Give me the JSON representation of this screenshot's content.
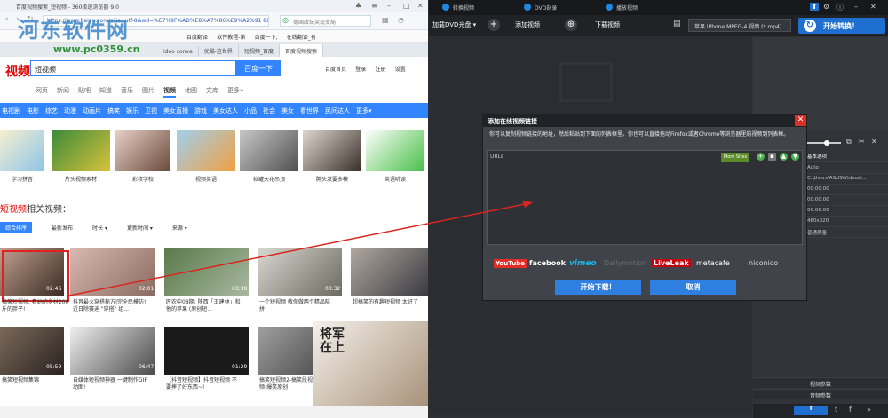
{
  "browser": {
    "title": "百度视频搜索_短视频 - 360极速浏览器 9.0",
    "url": "https://www.baidu.com/s?ie=utf-8&wd=%E7%9F%AD%E8%A7%86%E9%A2%91 8&word=%E6%9",
    "search_placeholder": "德国政坛突现变局",
    "bookmarks": [
      "百度翻译",
      "软件教程-第",
      "百度一下,",
      "在线翻译_有"
    ],
    "tabs": [
      "ideo conve",
      "优酷-这世界",
      "短视频_百度",
      "百度视频搜索"
    ],
    "watermark": "河东软件网",
    "watermark_url": "www.pc0359.cn"
  },
  "baidu": {
    "logo": "视频",
    "query": "短视频",
    "search_button": "百度一下",
    "links": [
      "百度首页",
      "登录",
      "注册",
      "设置"
    ],
    "nav1": [
      "网页",
      "新闻",
      "贴吧",
      "知道",
      "音乐",
      "图片",
      "视频",
      "地图",
      "文库",
      "更多»"
    ],
    "nav2": [
      "电视剧",
      "电影",
      "综艺",
      "动漫",
      "动画片",
      "搞笑",
      "娱乐",
      "卫视",
      "美女直播",
      "游戏",
      "美女达人",
      "小品",
      "社会",
      "美女",
      "看世界",
      "民间达人",
      "更多▾"
    ],
    "top_thumbs": [
      "学习拼音",
      "片头视频素材",
      "彩妆学校",
      "视频英语",
      "软罐天花吊顶",
      "肿头发要多模",
      "英语听读"
    ],
    "related_prefix": "短视频",
    "related_suffix": "相关视频：",
    "sort_tabs": [
      "综合排序",
      "最新发布",
      "时长 ▾",
      "更新时间 ▾",
      "来源 ▾"
    ],
    "videos": [
      {
        "dur": "02:46",
        "cap": "搞笑短视频, 看她的身材200斤的胖子!"
      },
      {
        "dur": "02:01",
        "cap": "抖音最火穿搭秘方|完全民模仿! 近日除赛迪 \"穿搭\" 组..."
      },
      {
        "dur": "03:38",
        "cap": "匠农中08期: 陕西「王建林」和他的苹果 (原创短..."
      },
      {
        "dur": "03:32",
        "cap": "一个短视频 教你做两个精品陪拼"
      },
      {
        "dur": "",
        "cap": "超搞笑的有趣短视频 太好了"
      },
      {
        "dur": "05:59",
        "cap": "搞笑短视频集锦"
      },
      {
        "dur": "06:47",
        "cap": "自媒体短视频神器 一键制作GIF动图!"
      },
      {
        "dur": "01:29",
        "cap": "【抖音短视频】抖音短视频 不要摔了好东西~!"
      },
      {
        "dur": "",
        "cap": "搞笑短视频2-搞笑段视频-爆笑原创"
      },
      {
        "dur": "",
        "cap": "将军在上"
      }
    ]
  },
  "app": {
    "tabs": [
      "转换视频",
      "DVD刻录",
      "播放视频"
    ],
    "toolbar": [
      "加载DVD光盘 ▾",
      "添加视频",
      "下载视频"
    ],
    "profile": "苹果 iPhone MPEG-4 视频 (*.mp4)",
    "convert": "开始转换！",
    "panel_header": "基本选项",
    "params": [
      "Auto",
      "C:\\Users\\ASUS\\Videos\\...",
      "00:00:00",
      "00:00:00",
      "00:00:00",
      "480x320",
      "普通质量"
    ],
    "video_params": "视频参数",
    "audio_params": "音频参数"
  },
  "dialog": {
    "title": "添加在线视频链接",
    "desc": "你可以复制视频链接的地址，然后粘贴到下面的列表框里。你也可以直接拖动Firefox或者Chrome等浏览器里的视频到列表框。",
    "urls_label": "URLs",
    "more_sites": "More Sites",
    "sites": [
      "YouTube",
      "facebook",
      "vimeo",
      "Dailymotion",
      "LiveLeak",
      "metacafe",
      "niconico"
    ],
    "start": "开始下载！",
    "cancel": "取消"
  },
  "colors": {
    "baidu_blue": "#3385ff",
    "red": "#e0211e",
    "app_blue": "#1e6fd0"
  }
}
